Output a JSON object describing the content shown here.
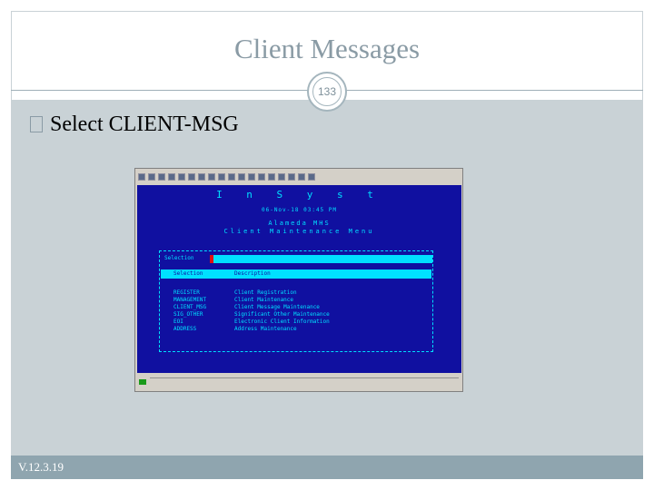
{
  "slide": {
    "title": "Client Messages",
    "page_number": "133",
    "bullet": "Select CLIENT-MSG",
    "footer": "V.12.3.19"
  },
  "terminal": {
    "app_name": "I n S y s t",
    "date_time": "06-Nov-18  03:45 PM",
    "org": "Alameda MHS",
    "menu_title": "Client Maintenance Menu",
    "selection_label": "Selection",
    "selection_value": "",
    "columns": {
      "selection": "Selection",
      "description": "Description"
    },
    "items": [
      {
        "code": "REGISTER",
        "description": "Client Registration"
      },
      {
        "code": "MANAGEMENT",
        "description": "Client Maintenance"
      },
      {
        "code": "CLIENT_MSG",
        "description": "Client Message Maintenance"
      },
      {
        "code": "SIG_OTHER",
        "description": "Significant Other Maintenance"
      },
      {
        "code": "EOI",
        "description": "Electronic Client Information"
      },
      {
        "code": "ADDRESS",
        "description": "Address Maintenance"
      }
    ]
  },
  "colors": {
    "terminal_bg": "#1010a0",
    "terminal_fg": "#00e0ff",
    "footer_bg": "#8fa5af",
    "title": "#8a9ba5"
  }
}
